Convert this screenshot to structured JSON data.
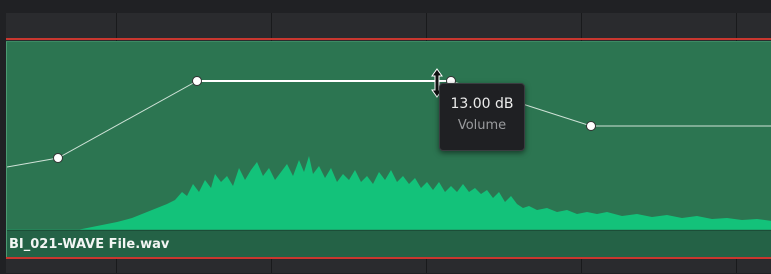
{
  "clip": {
    "name": "BI_021-WAVE File.wav"
  },
  "volume_tooltip": {
    "value": "13.00 dB",
    "label": "Volume"
  },
  "colors": {
    "clip_fill": "#2c7551",
    "waveform": "#13c27a",
    "keyframe_line": "#e8efe9",
    "playhead": "#c9372f"
  }
}
